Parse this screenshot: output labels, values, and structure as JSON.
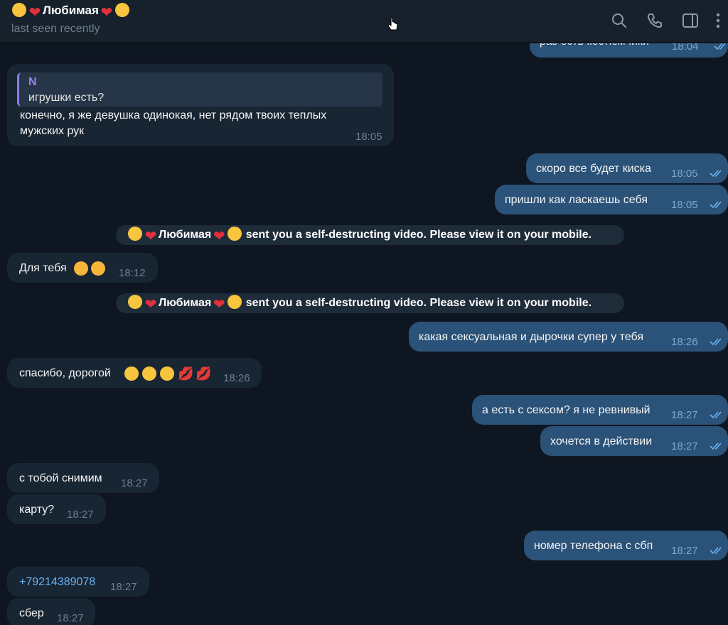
{
  "header": {
    "title": "Любимая",
    "status": "last seen recently",
    "icons": [
      "search-icon",
      "phone-icon",
      "sidebar-toggle-icon",
      "more-icon"
    ]
  },
  "messages": {
    "m0": {
      "text": "раз есть костюмчики",
      "time": "18:04"
    },
    "m1": {
      "reply_name": "N",
      "reply_text": "игрушки есть?",
      "line1": "конечно, я же девушка одинокая, нет рядом твоих теплых",
      "line2": "мужских рук",
      "time": "18:05"
    },
    "m2": {
      "text": "скоро все будет киска",
      "time": "18:05"
    },
    "m3": {
      "text": "пришли как ласкаешь себя",
      "time": "18:05"
    },
    "s1": {
      "name": "Любимая",
      "text": "sent you a self-destructing video. Please view it on your mobile."
    },
    "m4": {
      "text": "Для тебя",
      "time": "18:12"
    },
    "s2": {
      "name": "Любимая",
      "text": "sent you a self-destructing video. Please view it on your mobile."
    },
    "m5": {
      "text": "какая сексуальная и дырочки супер у тебя",
      "time": "18:26"
    },
    "m6": {
      "text": "спасибо, дорогой",
      "time": "18:26"
    },
    "m7": {
      "text": "а есть с сексом? я не ревнивый",
      "time": "18:27"
    },
    "m8": {
      "text": "хочется в действии",
      "time": "18:27"
    },
    "m9": {
      "text": "с тобой снимим",
      "time": "18:27"
    },
    "m10": {
      "text": "карту?",
      "time": "18:27"
    },
    "m11": {
      "text": "номер телефона с сбп",
      "time": "18:27"
    },
    "m12": {
      "text": "+79214389078",
      "time": "18:27"
    },
    "m13": {
      "text": "сбер",
      "time": "18:27"
    }
  },
  "colors": {
    "background": "#0e1621",
    "incoming": "#182533",
    "outgoing": "#2b5278",
    "link": "#6ab3f3",
    "reply_accent": "#9d86ee"
  }
}
